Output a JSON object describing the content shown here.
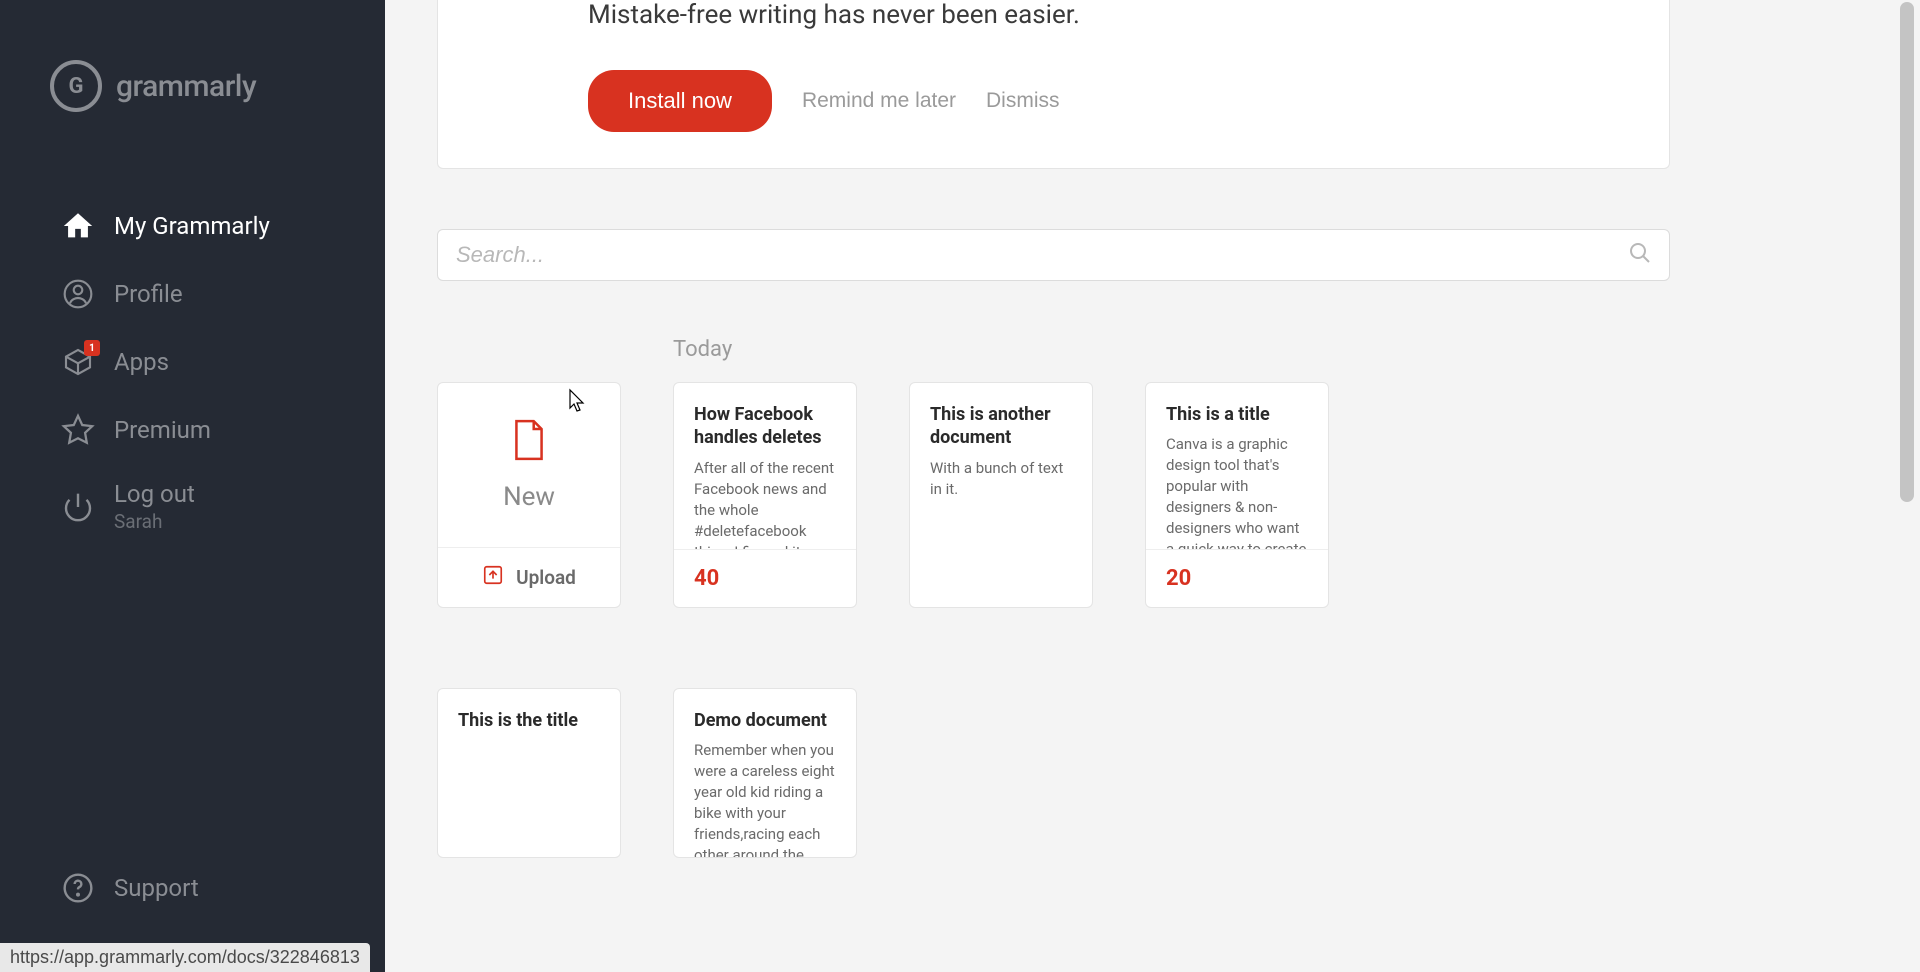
{
  "brand": "grammarly",
  "logo_letter": "G",
  "nav": {
    "my_grammarly": "My Grammarly",
    "profile": "Profile",
    "apps": "Apps",
    "apps_badge": "1",
    "premium": "Premium",
    "logout": "Log out",
    "user_name": "Sarah",
    "support": "Support"
  },
  "banner": {
    "subtitle": "Mistake-free writing has never been easier.",
    "install": "Install now",
    "remind": "Remind me later",
    "dismiss": "Dismiss"
  },
  "search": {
    "placeholder": "Search..."
  },
  "section_today": "Today",
  "new_card": {
    "label": "New",
    "upload": "Upload"
  },
  "docs_row1": [
    {
      "title": "How Facebook handles deletes",
      "preview": "After all of the recent Facebook news and the whole #deletefacebook thing, I figured it would be a good time to see",
      "score": "40"
    },
    {
      "title": "This is another document",
      "preview": "With a bunch of text in it.",
      "score": ""
    },
    {
      "title": "This is a title",
      "preview": "Canva is a graphic design tool that's popular with designers & non-designers who want a quick way to create logos, social",
      "score": "20"
    }
  ],
  "docs_row2": [
    {
      "title": "This is the title",
      "preview": "",
      "score": ""
    },
    {
      "title": "Demo document",
      "preview": "Remember when you were a careless eight year old kid riding a bike with your friends,racing each other around the",
      "score": ""
    }
  ],
  "status_url": "https://app.grammarly.com/docs/322846813"
}
